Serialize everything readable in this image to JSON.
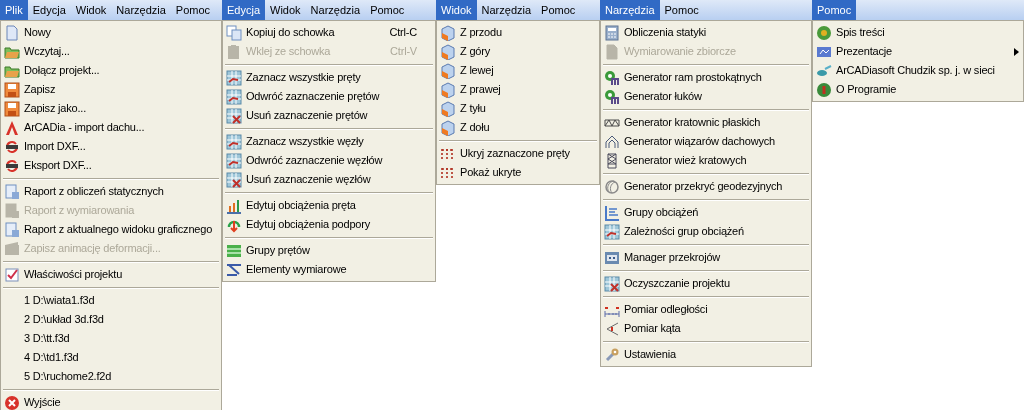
{
  "menus": [
    {
      "menubar": [
        {
          "label": "Plik",
          "selected": true
        },
        {
          "label": "Edycja",
          "selected": false
        },
        {
          "label": "Widok",
          "selected": false
        },
        {
          "label": "Narzędzia",
          "selected": false
        },
        {
          "label": "Pomoc",
          "selected": false
        }
      ],
      "items": [
        {
          "kind": "item",
          "label": "Nowy",
          "disabled": false
        },
        {
          "kind": "item",
          "label": "Wczytaj...",
          "disabled": false
        },
        {
          "kind": "item",
          "label": "Dołącz projekt...",
          "disabled": false
        },
        {
          "kind": "item",
          "label": "Zapisz",
          "disabled": false
        },
        {
          "kind": "item",
          "label": "Zapisz jako...",
          "disabled": false
        },
        {
          "kind": "item",
          "label": "ArCADia - import dachu...",
          "disabled": false
        },
        {
          "kind": "item",
          "label": "Import DXF...",
          "disabled": false
        },
        {
          "kind": "item",
          "label": "Eksport DXF...",
          "disabled": false
        },
        {
          "kind": "separator"
        },
        {
          "kind": "item",
          "label": "Raport z obliczeń statycznych",
          "disabled": false
        },
        {
          "kind": "item",
          "label": "Raport z wymiarowania",
          "disabled": true
        },
        {
          "kind": "item",
          "label": "Raport z aktualnego widoku graficznego",
          "disabled": false
        },
        {
          "kind": "item",
          "label": "Zapisz animację deformacji...",
          "disabled": true
        },
        {
          "kind": "separator"
        },
        {
          "kind": "item",
          "label": "Właściwości projektu",
          "disabled": false
        },
        {
          "kind": "separator"
        },
        {
          "kind": "item",
          "label": "1 D:\\wiata1.f3d",
          "disabled": false
        },
        {
          "kind": "item",
          "label": "2 D:\\układ 3d.f3d",
          "disabled": false
        },
        {
          "kind": "item",
          "label": "3 D:\\tt.f3d",
          "disabled": false
        },
        {
          "kind": "item",
          "label": "4 D:\\td1.f3d",
          "disabled": false
        },
        {
          "kind": "item",
          "label": "5 D:\\ruchome2.f2d",
          "disabled": false
        },
        {
          "kind": "separator"
        },
        {
          "kind": "item",
          "label": "Wyjście",
          "disabled": false
        }
      ]
    },
    {
      "menubar": [
        {
          "label": "Edycja",
          "selected": true
        },
        {
          "label": "Widok",
          "selected": false
        },
        {
          "label": "Narzędzia",
          "selected": false
        },
        {
          "label": "Pomoc",
          "selected": false
        }
      ],
      "items": [
        {
          "kind": "item",
          "label": "Kopiuj do schowka",
          "shortcut": "Ctrl-C",
          "disabled": false
        },
        {
          "kind": "item",
          "label": "Wklej ze schowka",
          "shortcut": "Ctrl-V",
          "disabled": true
        },
        {
          "kind": "separator"
        },
        {
          "kind": "item",
          "label": "Zaznacz wszystkie pręty",
          "disabled": false
        },
        {
          "kind": "item",
          "label": "Odwróć zaznaczenie prętów",
          "disabled": false
        },
        {
          "kind": "item",
          "label": "Usuń zaznaczenie prętów",
          "disabled": false
        },
        {
          "kind": "separator"
        },
        {
          "kind": "item",
          "label": "Zaznacz wszystkie węzły",
          "disabled": false
        },
        {
          "kind": "item",
          "label": "Odwróć zaznaczenie węzłów",
          "disabled": false
        },
        {
          "kind": "item",
          "label": "Usuń zaznaczenie węzłów",
          "disabled": false
        },
        {
          "kind": "separator"
        },
        {
          "kind": "item",
          "label": "Edytuj obciążenia pręta",
          "disabled": false
        },
        {
          "kind": "item",
          "label": "Edytuj obciążenia podpory",
          "disabled": false
        },
        {
          "kind": "separator"
        },
        {
          "kind": "item",
          "label": "Grupy prętów",
          "disabled": false
        },
        {
          "kind": "item",
          "label": "Elementy wymiarowe",
          "disabled": false
        }
      ]
    },
    {
      "menubar": [
        {
          "label": "Widok",
          "selected": true
        },
        {
          "label": "Narzędzia",
          "selected": false
        },
        {
          "label": "Pomoc",
          "selected": false
        }
      ],
      "items": [
        {
          "kind": "item",
          "label": "Z przodu",
          "disabled": false
        },
        {
          "kind": "item",
          "label": "Z góry",
          "disabled": false
        },
        {
          "kind": "item",
          "label": "Z lewej",
          "disabled": false
        },
        {
          "kind": "item",
          "label": "Z prawej",
          "disabled": false
        },
        {
          "kind": "item",
          "label": "Z tyłu",
          "disabled": false
        },
        {
          "kind": "item",
          "label": "Z dołu",
          "disabled": false
        },
        {
          "kind": "separator"
        },
        {
          "kind": "item",
          "label": "Ukryj zaznaczone pręty",
          "disabled": false
        },
        {
          "kind": "item",
          "label": "Pokaż ukryte",
          "disabled": false
        }
      ]
    },
    {
      "menubar": [
        {
          "label": "Narzędzia",
          "selected": true
        },
        {
          "label": "Pomoc",
          "selected": false
        }
      ],
      "items": [
        {
          "kind": "item",
          "label": "Obliczenia statyki",
          "disabled": false
        },
        {
          "kind": "item",
          "label": "Wymiarowanie zbiorcze",
          "disabled": true
        },
        {
          "kind": "separator"
        },
        {
          "kind": "item",
          "label": "Generator ram prostokątnych",
          "disabled": false
        },
        {
          "kind": "item",
          "label": "Generator łuków",
          "disabled": false
        },
        {
          "kind": "separator"
        },
        {
          "kind": "item",
          "label": "Generator kratownic płaskich",
          "disabled": false
        },
        {
          "kind": "item",
          "label": "Generator wiązarów dachowych",
          "disabled": false
        },
        {
          "kind": "item",
          "label": "Generator wież kratowych",
          "disabled": false
        },
        {
          "kind": "separator"
        },
        {
          "kind": "item",
          "label": "Generator przekryć geodezyjnych",
          "disabled": false
        },
        {
          "kind": "separator"
        },
        {
          "kind": "item",
          "label": "Grupy obciążeń",
          "disabled": false
        },
        {
          "kind": "item",
          "label": "Zależności grup obciążeń",
          "disabled": false
        },
        {
          "kind": "separator"
        },
        {
          "kind": "item",
          "label": "Manager przekrojów",
          "disabled": false
        },
        {
          "kind": "separator"
        },
        {
          "kind": "item",
          "label": "Oczyszczanie projektu",
          "disabled": false
        },
        {
          "kind": "separator"
        },
        {
          "kind": "item",
          "label": "Pomiar odległości",
          "disabled": false
        },
        {
          "kind": "item",
          "label": "Pomiar kąta",
          "disabled": false
        },
        {
          "kind": "separator"
        },
        {
          "kind": "item",
          "label": "Ustawienia",
          "disabled": false
        }
      ]
    },
    {
      "menubar": [
        {
          "label": "Pomoc",
          "selected": true
        }
      ],
      "items": [
        {
          "kind": "item",
          "label": "Spis treści",
          "disabled": false,
          "submenu": false
        },
        {
          "kind": "item",
          "label": "Prezentacje",
          "disabled": false,
          "submenu": true
        },
        {
          "kind": "item",
          "label": "ArCADiasoft Chudzik sp. j. w sieci",
          "disabled": false,
          "submenu": false
        },
        {
          "kind": "item",
          "label": "O Programie",
          "disabled": false,
          "submenu": false
        }
      ]
    }
  ]
}
